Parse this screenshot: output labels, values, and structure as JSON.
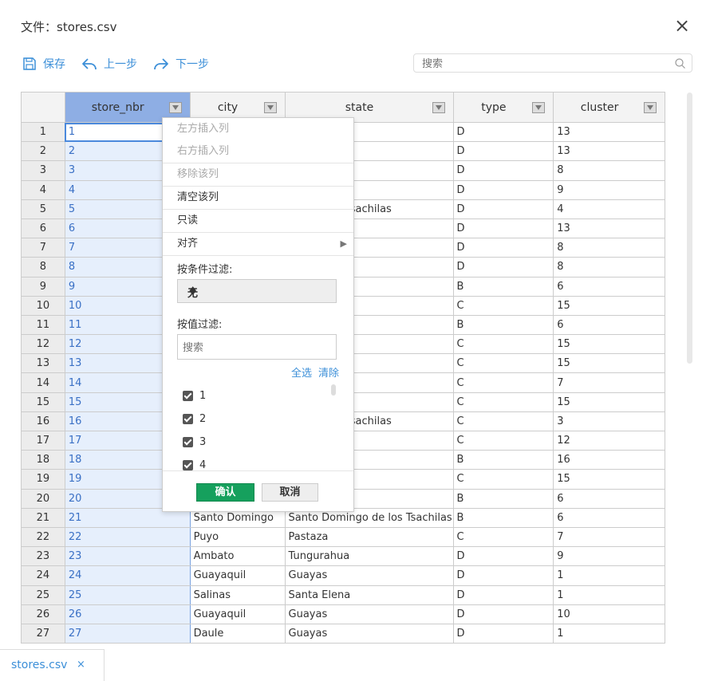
{
  "title": "文件：stores.csv",
  "close_icon": "×",
  "toolbar": {
    "save": "保存",
    "undo": "上一步",
    "redo": "下一步"
  },
  "search": {
    "placeholder": "搜索"
  },
  "columns": [
    "store_nbr",
    "city",
    "state",
    "type",
    "cluster"
  ],
  "rows": [
    {
      "n": "1",
      "store": "1",
      "city": "",
      "state": "",
      "type": "D",
      "cluster": "13"
    },
    {
      "n": "2",
      "store": "2",
      "city": "",
      "state": "",
      "type": "D",
      "cluster": "13"
    },
    {
      "n": "3",
      "store": "3",
      "city": "",
      "state": "",
      "type": "D",
      "cluster": "8"
    },
    {
      "n": "4",
      "store": "4",
      "city": "",
      "state": "",
      "type": "D",
      "cluster": "9"
    },
    {
      "n": "5",
      "store": "5",
      "city": "",
      "state": "ngo de los Tsachilas",
      "type": "D",
      "cluster": "4"
    },
    {
      "n": "6",
      "store": "6",
      "city": "",
      "state": "",
      "type": "D",
      "cluster": "13"
    },
    {
      "n": "7",
      "store": "7",
      "city": "",
      "state": "",
      "type": "D",
      "cluster": "8"
    },
    {
      "n": "8",
      "store": "8",
      "city": "",
      "state": "",
      "type": "D",
      "cluster": "8"
    },
    {
      "n": "9",
      "store": "9",
      "city": "",
      "state": "",
      "type": "B",
      "cluster": "6"
    },
    {
      "n": "10",
      "store": "10",
      "city": "",
      "state": "",
      "type": "C",
      "cluster": "15"
    },
    {
      "n": "11",
      "store": "11",
      "city": "",
      "state": "",
      "type": "B",
      "cluster": "6"
    },
    {
      "n": "12",
      "store": "12",
      "city": "",
      "state": "",
      "type": "C",
      "cluster": "15"
    },
    {
      "n": "13",
      "store": "13",
      "city": "",
      "state": "",
      "type": "C",
      "cluster": "15"
    },
    {
      "n": "14",
      "store": "14",
      "city": "",
      "state": "",
      "type": "C",
      "cluster": "7"
    },
    {
      "n": "15",
      "store": "15",
      "city": "",
      "state": "",
      "type": "C",
      "cluster": "15"
    },
    {
      "n": "16",
      "store": "16",
      "city": "",
      "state": "ngo de los Tsachilas",
      "type": "C",
      "cluster": "3"
    },
    {
      "n": "17",
      "store": "17",
      "city": "",
      "state": "",
      "type": "C",
      "cluster": "12"
    },
    {
      "n": "18",
      "store": "18",
      "city": "",
      "state": "",
      "type": "B",
      "cluster": "16"
    },
    {
      "n": "19",
      "store": "19",
      "city": "",
      "state": "",
      "type": "C",
      "cluster": "15"
    },
    {
      "n": "20",
      "store": "20",
      "city": "",
      "state": "",
      "type": "B",
      "cluster": "6"
    },
    {
      "n": "21",
      "store": "21",
      "city": "Santo Domingo",
      "state": "Santo Domingo de los Tsachilas",
      "type": "B",
      "cluster": "6"
    },
    {
      "n": "22",
      "store": "22",
      "city": "Puyo",
      "state": "Pastaza",
      "type": "C",
      "cluster": "7"
    },
    {
      "n": "23",
      "store": "23",
      "city": "Ambato",
      "state": "Tungurahua",
      "type": "D",
      "cluster": "9"
    },
    {
      "n": "24",
      "store": "24",
      "city": "Guayaquil",
      "state": "Guayas",
      "type": "D",
      "cluster": "1"
    },
    {
      "n": "25",
      "store": "25",
      "city": "Salinas",
      "state": "Santa Elena",
      "type": "D",
      "cluster": "1"
    },
    {
      "n": "26",
      "store": "26",
      "city": "Guayaquil",
      "state": "Guayas",
      "type": "D",
      "cluster": "10"
    },
    {
      "n": "27",
      "store": "27",
      "city": "Daule",
      "state": "Guayas",
      "type": "D",
      "cluster": "1"
    }
  ],
  "menu": {
    "insert_left": "左方插入列",
    "insert_right": "右方插入列",
    "remove_col": "移除该列",
    "clear_col": "清空该列",
    "read_only": "只读",
    "align": "对齐",
    "filter_by_condition": "按条件过滤:",
    "condition_value": "无",
    "filter_by_value": "按值过滤:",
    "value_search_placeholder": "搜索",
    "select_all": "全选",
    "clear": "清除",
    "values": [
      "1",
      "2",
      "3",
      "4"
    ],
    "ok": "确认",
    "cancel": "取消"
  },
  "bottom_tab": {
    "label": "stores.csv",
    "close": "×"
  },
  "colors": {
    "accent": "#3c8fd8",
    "selected_header": "#8eaee4",
    "ok_button": "#16a05d"
  }
}
